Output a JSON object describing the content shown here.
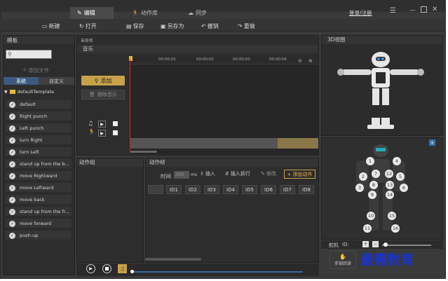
{
  "header": {
    "tabs": [
      {
        "label": "编辑",
        "icon": "edit-icon"
      },
      {
        "label": "动作库",
        "icon": "running-figure-icon"
      },
      {
        "label": "同步",
        "icon": "cloud-icon"
      }
    ],
    "login_label": "登录/注册"
  },
  "toolbar": {
    "items": [
      {
        "label": "新建",
        "icon": "new-file-icon"
      },
      {
        "label": "打开",
        "icon": "open-icon"
      },
      {
        "label": "保存",
        "icon": "save-icon"
      },
      {
        "label": "另存为",
        "icon": "save-as-icon"
      },
      {
        "label": "撤销",
        "icon": "undo-icon"
      },
      {
        "label": "重做",
        "icon": "redo-icon"
      }
    ]
  },
  "left": {
    "title": "模板",
    "add_file_label": "添加文件",
    "tabs": [
      "系统",
      "自定义"
    ],
    "folder": "defaultTemplate",
    "items": [
      "default",
      "Right punch",
      "Left punch",
      "turn Right",
      "turn Left",
      "stand up from the b...",
      "move Rightward",
      "move Leftward",
      "move back",
      "stand up from the fr...",
      "move forward",
      "push-up"
    ]
  },
  "center": {
    "file_name": "未命名",
    "music_label": "音乐",
    "add_button": "添加",
    "delete_music": "删除音乐",
    "ticks": [
      "00:00:01",
      "00:00:02",
      "00:00:03",
      "00:00:04"
    ],
    "action_group_label": "动作组",
    "action_frame_label": "动作帧",
    "time_label": "时间",
    "time_value": "200",
    "time_unit": "ms",
    "insert_label": "插入",
    "insert_split_label": "插入拆行",
    "modify_label": "修改",
    "add_action_label": "添加动作",
    "ids": [
      "ID1",
      "ID2",
      "ID3",
      "ID4",
      "ID5",
      "ID6",
      "ID7",
      "ID8"
    ]
  },
  "right": {
    "title": "3D视图",
    "servo_label": "舵机",
    "id_label": "ID:",
    "manual_button": "手部回读",
    "joints": [
      "1",
      "2",
      "3",
      "4",
      "5",
      "6",
      "7",
      "8",
      "9",
      "10",
      "11",
      "12",
      "13",
      "14",
      "15",
      "16"
    ]
  },
  "watermark": "最需教育",
  "colors": {
    "accent": "#c8a24a",
    "playhead": "#d22",
    "timeline_tail": "#8a7748"
  }
}
